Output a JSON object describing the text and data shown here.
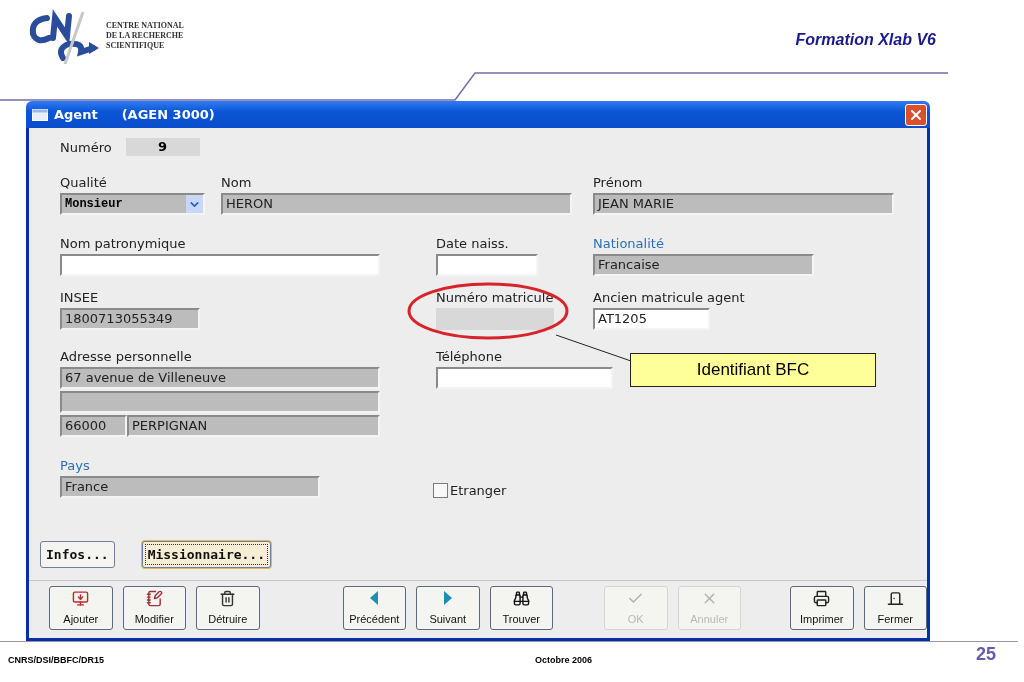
{
  "slide": {
    "logo_text": [
      "CENTRE NATIONAL",
      "DE LA RECHERCHE",
      "SCIENTIFIQUE"
    ],
    "title": "Formation Xlab V6",
    "footer_left": "CNRS/DSI/BBFC/DR15",
    "footer_center": "Octobre 2006",
    "page_number": "25"
  },
  "window": {
    "title": "Agent",
    "code": "(AGEN 3000)"
  },
  "numero": {
    "label": "Numéro",
    "value": "9"
  },
  "qualite": {
    "label": "Qualité",
    "value": "Monsieur"
  },
  "nom": {
    "label": "Nom",
    "value": "HERON",
    "editable": false,
    "disabled": false,
    "link": false
  },
  "prenom": {
    "label": "Prénom",
    "value": "JEAN MARIE",
    "editable": false,
    "disabled": false,
    "link": false
  },
  "nom_patronymique": {
    "label": "Nom patronymique",
    "editable": true,
    "disabled": false,
    "link": false
  },
  "date_naiss": {
    "label": "Date naiss.",
    "editable": true,
    "disabled": false,
    "link": false
  },
  "nationalite": {
    "label": "Nationalité",
    "value": "Francaise",
    "editable": false,
    "disabled": false,
    "link": true
  },
  "insee": {
    "label": "INSEE",
    "value": "1800713055349",
    "editable": false,
    "disabled": false,
    "link": false
  },
  "numero_matricule": {
    "label": "Numéro matricule",
    "editable": false,
    "disabled": true,
    "link": false
  },
  "ancien_matricule": {
    "label": "Ancien matricule agent",
    "value": "AT1205",
    "editable": true,
    "disabled": false,
    "link": false
  },
  "adresse": {
    "label": "Adresse personnelle",
    "street": "67 avenue de Villeneuve",
    "postcode": "66000",
    "city": "PERPIGNAN",
    "editable": false,
    "disabled": false,
    "link": false
  },
  "telephone": {
    "label": "Téléphone",
    "editable": true,
    "disabled": false,
    "link": false
  },
  "pays": {
    "label": "Pays",
    "value": "France",
    "editable": false,
    "disabled": false,
    "link": true
  },
  "etranger": {
    "label": "Etranger",
    "checked": false
  },
  "side_buttons": [
    {
      "label": "Infos...",
      "focused": false
    },
    {
      "label": "Missionnaire...",
      "focused": true
    }
  ],
  "toolbar": [
    {
      "label": "Ajouter",
      "disabled": false
    },
    {
      "label": "Modifier",
      "disabled": false
    },
    {
      "label": "Détruire",
      "disabled": false
    },
    {
      "label": "Précédent",
      "disabled": false
    },
    {
      "label": "Suivant",
      "disabled": false
    },
    {
      "label": "Trouver",
      "disabled": false
    },
    {
      "label": "OK",
      "disabled": true
    },
    {
      "label": "Annuler",
      "disabled": true
    },
    {
      "label": "Imprimer",
      "disabled": false
    },
    {
      "label": "Fermer",
      "disabled": false
    }
  ],
  "callout": {
    "text": "Identifiant BFC"
  }
}
